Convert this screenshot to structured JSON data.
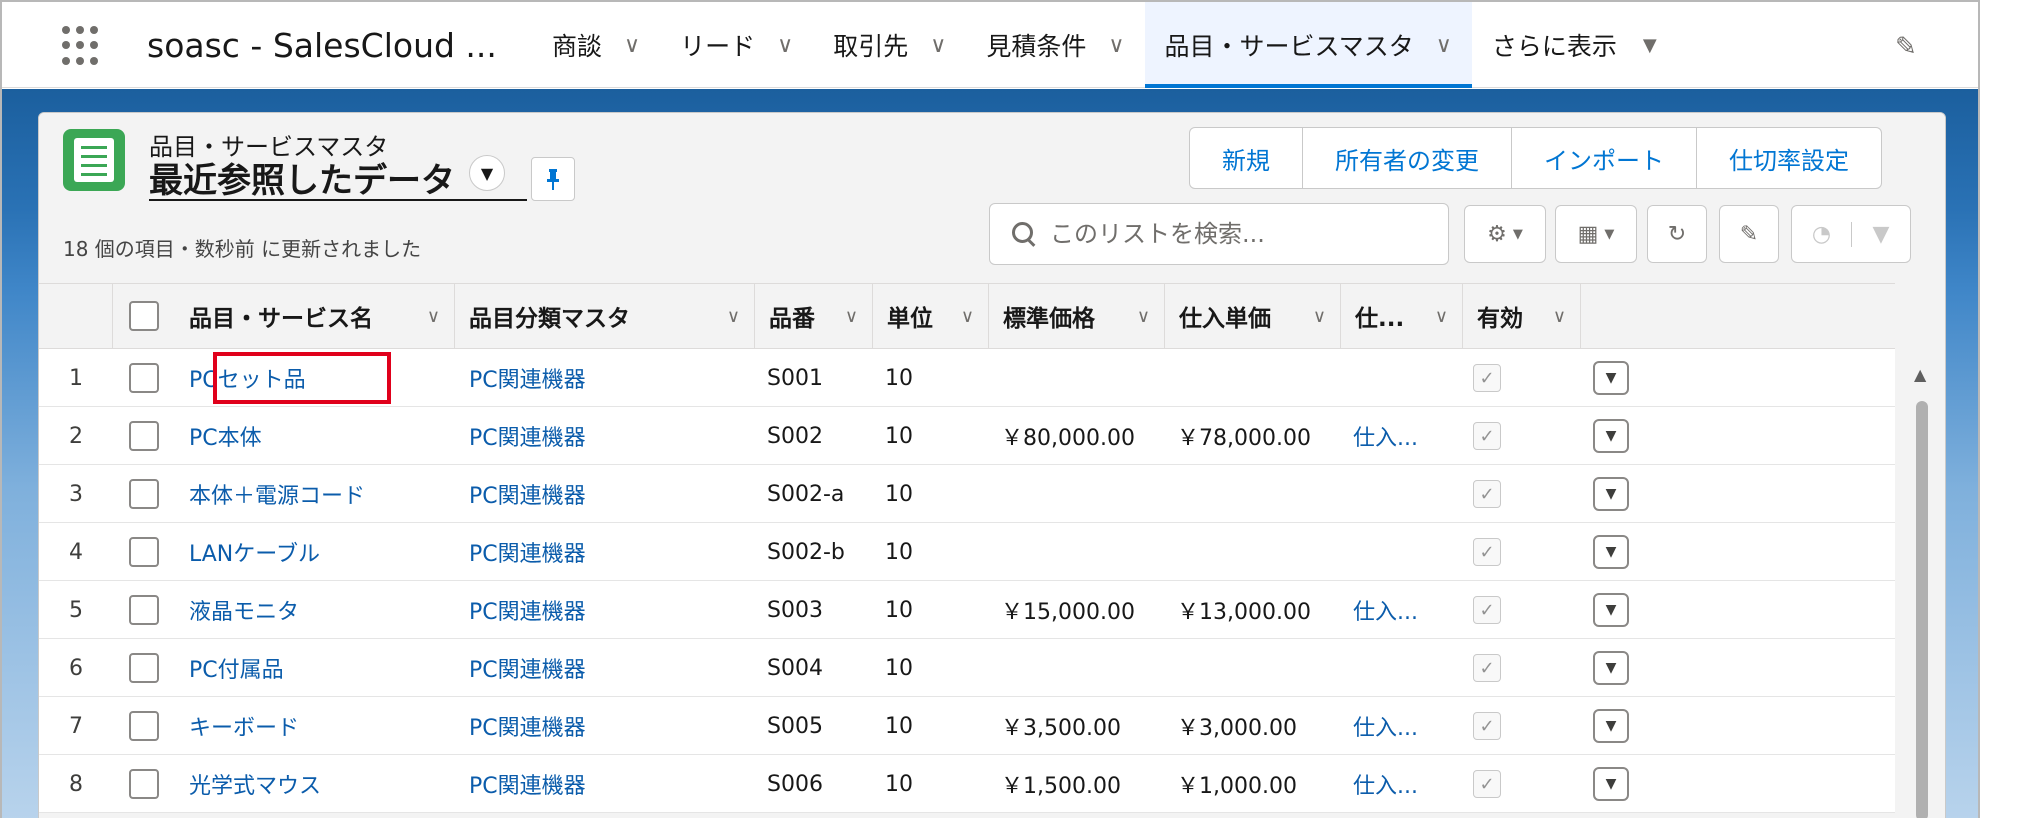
{
  "app": {
    "name": "soasc - SalesCloud ...",
    "tabs": [
      {
        "label": "商談",
        "active": false
      },
      {
        "label": "リード",
        "active": false
      },
      {
        "label": "取引先",
        "active": false
      },
      {
        "label": "見積条件",
        "active": false
      },
      {
        "label": "品目・サービスマスタ",
        "active": true
      }
    ],
    "more_label": "さらに表示"
  },
  "list": {
    "object_type": "品目・サービスマスタ",
    "name": "最近参照したデータ",
    "meta": "18 個の項目・数秒前 に更新されました",
    "buttons": [
      "新規",
      "所有者の変更",
      "インポート",
      "仕切率設定"
    ],
    "search_placeholder": "このリストを検索..."
  },
  "table": {
    "columns": [
      "品目・サービス名",
      "品目分類マスタ",
      "品番",
      "単位",
      "標準価格",
      "仕入単価",
      "仕...",
      "有効"
    ],
    "rows": [
      {
        "num": "1",
        "name": "PCセット品",
        "category": "PC関連機器",
        "code": "S001",
        "unit": "10",
        "price": "",
        "cost": "",
        "supplier": "",
        "active": true
      },
      {
        "num": "2",
        "name": "PC本体",
        "category": "PC関連機器",
        "code": "S002",
        "unit": "10",
        "price": "￥80,000.00",
        "cost": "￥78,000.00",
        "supplier": "仕入...",
        "active": true
      },
      {
        "num": "3",
        "name": "本体＋電源コード",
        "category": "PC関連機器",
        "code": "S002-a",
        "unit": "10",
        "price": "",
        "cost": "",
        "supplier": "",
        "active": true
      },
      {
        "num": "4",
        "name": "LANケーブル",
        "category": "PC関連機器",
        "code": "S002-b",
        "unit": "10",
        "price": "",
        "cost": "",
        "supplier": "",
        "active": true
      },
      {
        "num": "5",
        "name": "液晶モニタ",
        "category": "PC関連機器",
        "code": "S003",
        "unit": "10",
        "price": "￥15,000.00",
        "cost": "￥13,000.00",
        "supplier": "仕入...",
        "active": true
      },
      {
        "num": "6",
        "name": "PC付属品",
        "category": "PC関連機器",
        "code": "S004",
        "unit": "10",
        "price": "",
        "cost": "",
        "supplier": "",
        "active": true
      },
      {
        "num": "7",
        "name": "キーボード",
        "category": "PC関連機器",
        "code": "S005",
        "unit": "10",
        "price": "￥3,500.00",
        "cost": "￥3,000.00",
        "supplier": "仕入...",
        "active": true
      },
      {
        "num": "8",
        "name": "光学式マウス",
        "category": "PC関連機器",
        "code": "S006",
        "unit": "10",
        "price": "￥1,500.00",
        "cost": "￥1,000.00",
        "supplier": "仕入...",
        "active": true
      }
    ]
  },
  "icons": {
    "app_launcher": "app-launcher-icon",
    "list_switcher": "chevron-down-icon",
    "pin": "pin-icon",
    "search": "search-icon",
    "settings": "gear-icon",
    "display_as": "table-icon",
    "refresh": "refresh-icon",
    "edit": "pencil-icon",
    "chart": "chart-icon",
    "filter": "filter-icon",
    "checkmark": "checkmark-icon",
    "row_menu": "caret-down-icon"
  },
  "colors": {
    "accent": "#0176d3",
    "link": "#0b5cab",
    "highlight": "#e0001b",
    "object_icon": "#3ba755"
  }
}
